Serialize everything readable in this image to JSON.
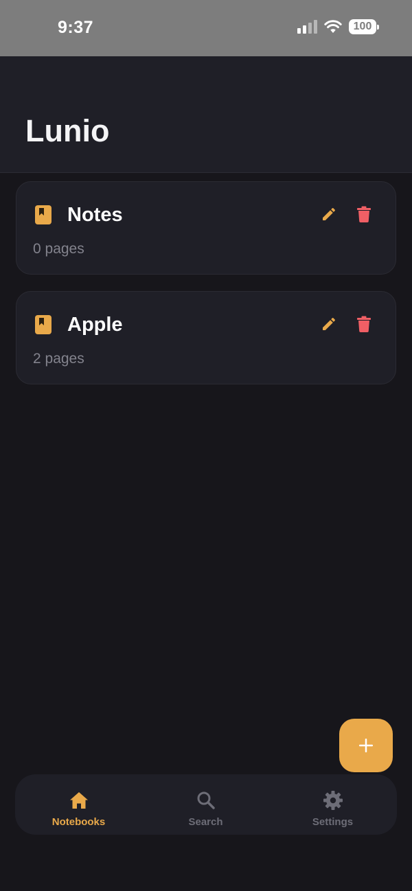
{
  "status_bar": {
    "time": "9:37",
    "battery": "100"
  },
  "header": {
    "title": "Lunio"
  },
  "notebooks": [
    {
      "title": "Notes",
      "subtitle": "0 pages"
    },
    {
      "title": "Apple",
      "subtitle": "2 pages"
    }
  ],
  "tabs": [
    {
      "label": "Notebooks",
      "icon": "home-icon",
      "active": true
    },
    {
      "label": "Search",
      "icon": "search-icon",
      "active": false
    },
    {
      "label": "Settings",
      "icon": "gear-icon",
      "active": false
    }
  ],
  "icons": {
    "notebook": "book-icon",
    "edit": "pencil-icon",
    "delete": "trash-icon",
    "add": "plus-icon"
  },
  "colors": {
    "accent": "#e9a94a",
    "danger": "#f05f65",
    "background": "#17161b",
    "card": "#1f1f27",
    "muted": "#83838d"
  }
}
